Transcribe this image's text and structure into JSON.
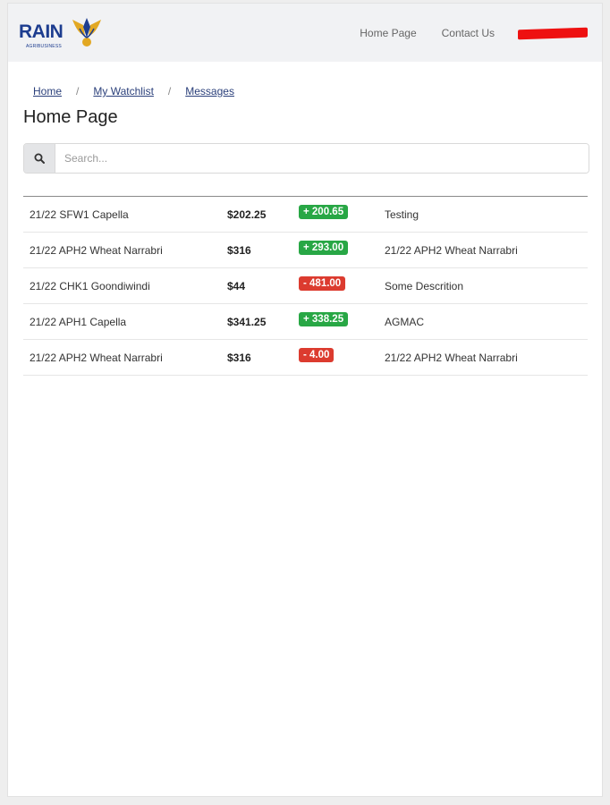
{
  "colors": {
    "brand": "#1d3d8f",
    "brand_gold": "#e2a823",
    "positive": "#28a745",
    "negative": "#dc3b2f",
    "navbar_bg": "#f1f2f4"
  },
  "navbar": {
    "logo_text": "RAIN",
    "logo_subtext": "AGRIBUSINESS",
    "links": [
      "Home Page",
      "Contact Us"
    ]
  },
  "breadcrumb": [
    "Home",
    "My Watchlist",
    "Messages"
  ],
  "page_title": "Home Page",
  "search": {
    "icon": "search-icon",
    "placeholder": "Search..."
  },
  "rows": [
    {
      "name": "21/22 SFW1 Capella",
      "price": "$202.25",
      "change": "+ 200.65",
      "trend": "up",
      "desc": "Testing"
    },
    {
      "name": "21/22 APH2 Wheat Narrabri",
      "price": "$316",
      "change": "+ 293.00",
      "trend": "up",
      "desc": "21/22 APH2 Wheat Narrabri"
    },
    {
      "name": "21/22 CHK1 Goondiwindi",
      "price": "$44",
      "change": "- 481.00",
      "trend": "down",
      "desc": "Some Descrition"
    },
    {
      "name": "21/22 APH1 Capella",
      "price": "$341.25",
      "change": "+ 338.25",
      "trend": "up",
      "desc": "AGMAC"
    },
    {
      "name": "21/22 APH2 Wheat Narrabri",
      "price": "$316",
      "change": "- 4.00",
      "trend": "down",
      "desc": "21/22 APH2 Wheat Narrabri"
    }
  ]
}
